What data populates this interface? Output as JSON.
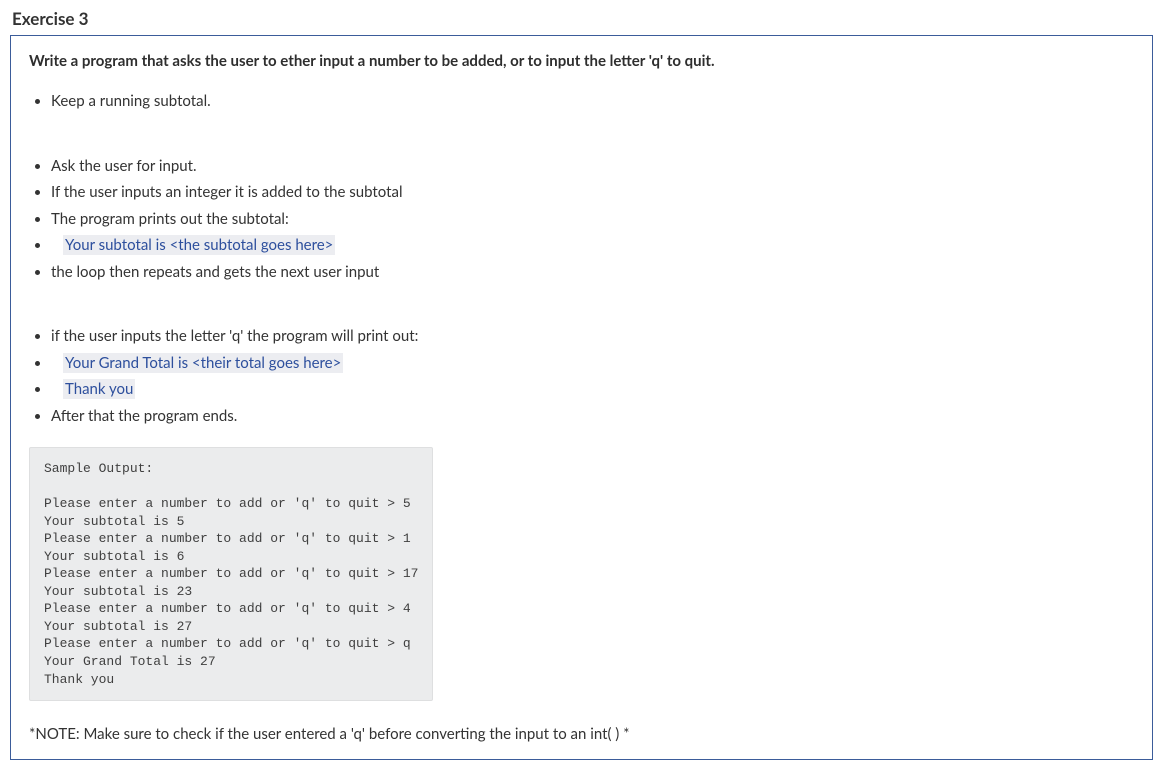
{
  "heading": "Exercise 3",
  "intro": "Write a program that asks the user to ether input a number to be added, or to input the letter 'q' to quit.",
  "group1": [
    {
      "text": "Keep a running subtotal."
    }
  ],
  "group2": [
    {
      "text": "Ask the user for input."
    },
    {
      "text": "If the user inputs an integer it is added to the subtotal"
    },
    {
      "text": "The program prints out the subtotal:"
    },
    {
      "highlight": "Your subtotal is <the subtotal goes here>",
      "indent": true
    },
    {
      "text": "the loop then repeats and gets the next user input"
    }
  ],
  "group3": [
    {
      "text": "if the user inputs the letter 'q' the program will print out:"
    },
    {
      "highlight": "Your Grand Total is <their total goes here>",
      "indent": true
    },
    {
      "highlight": "Thank you",
      "indent": true
    },
    {
      "text": "After that the program ends."
    }
  ],
  "sample_output": "Sample Output:\n\nPlease enter a number to add or 'q' to quit > 5\nYour subtotal is 5\nPlease enter a number to add or 'q' to quit > 1\nYour subtotal is 6\nPlease enter a number to add or 'q' to quit > 17\nYour subtotal is 23\nPlease enter a number to add or 'q' to quit > 4\nYour subtotal is 27\nPlease enter a number to add or 'q' to quit > q\nYour Grand Total is 27\nThank you",
  "note": "*NOTE: Make sure to check if the user entered a 'q' before converting the input to an int( ) *"
}
